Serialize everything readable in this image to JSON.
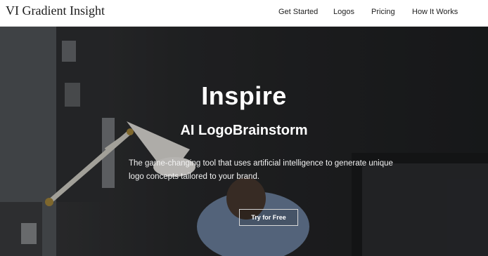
{
  "brand": {
    "logo_text": "VI Gradient Insight"
  },
  "nav": {
    "items": [
      {
        "label": "Get Started"
      },
      {
        "label": "Logos"
      },
      {
        "label": "Pricing"
      },
      {
        "label": "How It Works"
      }
    ]
  },
  "hero": {
    "title": "Inspire",
    "subtitle": "AI LogoBrainstorm",
    "description": "The game-changing tool that uses artificial intelligence to generate unique logo concepts tailored to your brand.",
    "cta_label": "Try for Free"
  }
}
